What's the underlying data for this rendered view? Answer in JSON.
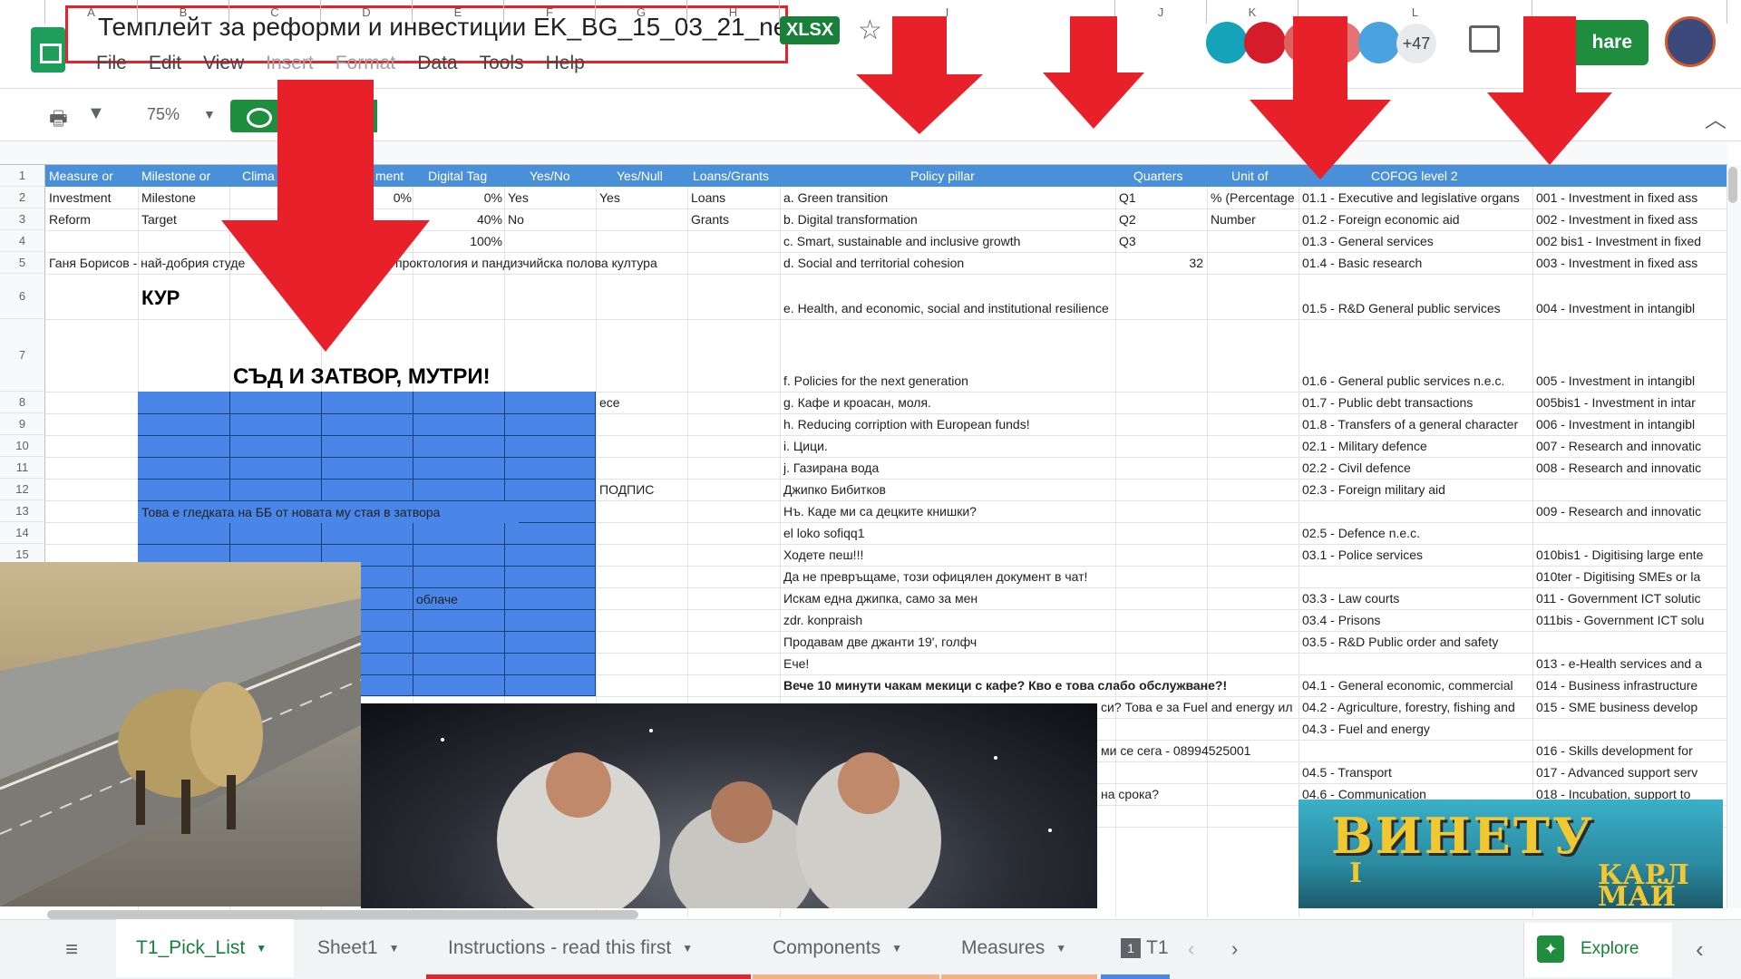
{
  "header": {
    "title": "Темплейт за реформи и инвестиции EK_BG_15_03_21_new",
    "file_badge": "XLSX",
    "menu": [
      "File",
      "Edit",
      "View",
      "Insert",
      "Format",
      "Data",
      "Tools",
      "Help"
    ],
    "collaborators_more": "+47",
    "share_label": "hare"
  },
  "toolbar": {
    "zoom": "75%"
  },
  "columns": [
    "A",
    "B",
    "C",
    "D",
    "E",
    "F",
    "G",
    "H",
    "I",
    "J",
    "K",
    "L"
  ],
  "rows": [
    "1",
    "2",
    "3",
    "4",
    "5",
    "6",
    "7",
    "8",
    "9",
    "10",
    "11",
    "12",
    "13",
    "14",
    "15"
  ],
  "header_row": {
    "a": "Measure or",
    "b": "Milestone or",
    "c": "Clima",
    "d": "ment",
    "e": "Digital Tag",
    "f": "Yes/No",
    "g": "Yes/Null",
    "h": "Loans/Grants",
    "i": "Policy pillar",
    "j": "Quarters",
    "k": "Unit of",
    "l": "COFOG level 2"
  },
  "cells": {
    "a2": "Investment",
    "b2": "Milestone",
    "d2": "0%",
    "e2": "0%",
    "f2": "Yes",
    "g2": "Yes",
    "h2": "Loans",
    "j2": "Q1",
    "k2": "% (Percentage",
    "a3": "Reform",
    "b3": "Target",
    "e3": "40%",
    "f3": "No",
    "h3": "Grants",
    "j3": "Q2",
    "k3": "Number",
    "d4": "%",
    "e4": "100%",
    "j4": "Q3",
    "a5": "Ганя Борисов - най-добрия студе",
    "d5": "проктология и пандизчийска полова култура",
    "j5": "32",
    "b6": "КУР",
    "c7": "СЪД И ЗАТВОР, МУТРИ!",
    "g8": "есе",
    "g12": "ПОДПИС",
    "b13": "Това е гледката на ББ от новата му стая в затвора",
    "e18": "облаче"
  },
  "policy_pillar": [
    "a. Green transition",
    "b. Digital transformation",
    "c. Smart, sustainable and inclusive growth",
    "d. Social and territorial cohesion",
    "e. Health, and economic, social and institutional resilience",
    "f. Policies for the next generation",
    "g. Кафе и кроасан, моля.",
    "h. Reducing corription with European funds!",
    "i. Цици.",
    "j. Газирана вода",
    "Джипко Бибитков",
    "Нъ. Каде ми са децките книшки?",
    "el loko sofiqq1",
    "Ходете пеш!!!",
    "Да не превръщаме, този офицялен документ в чат!",
    "Искам една джипка, само за мен",
    "zdr. konpraish",
    "Продавам две джанти 19', голфч",
    "Ече!",
    "Вече 10 минути чакам мекици с кафе? Кво е това слабо обслужване?!"
  ],
  "policy_pillar_tail": [
    "си? Това е за Fuel and energy ил",
    "ми се сега - 08994525001",
    "на срока?"
  ],
  "cofog": [
    "01.1 - Executive and legislative organs",
    "01.2 - Foreign economic aid",
    "01.3 - General services",
    "01.4 - Basic research",
    "01.5 - R&D General public services",
    "01.6 - General public services n.e.c.",
    "01.7 - Public debt transactions",
    "01.8 - Transfers of a general character",
    "02.1 - Military defence",
    "02.2 - Civil defence",
    "02.3 - Foreign military aid",
    "",
    "02.5 - Defence n.e.c.",
    "03.1 - Police services",
    "",
    "03.3 - Law courts",
    "03.4 - Prisons",
    "03.5 - R&D Public order and safety",
    "",
    "04.1 - General economic, commercial",
    "04.2 - Agriculture, forestry, fishing and",
    "04.3 - Fuel and energy",
    "",
    "04.5 - Transport",
    "04.6 - Communication"
  ],
  "col_m": [
    "001 - Investment in fixed ass",
    "002 - Investment in fixed ass",
    "002 bis1 - Investment in fixed",
    "003 - Investment in fixed ass",
    "004 - Investment in intangibl",
    "005 - Investment in intangibl",
    "005bis1 - Investment in intar",
    "006 - Investment in intangibl",
    "007 - Research and innovatic",
    "008 - Research and innovatic",
    "",
    "009 - Research and innovatic",
    "",
    "010bis1 - Digitising large ente",
    "010ter - Digitising SMEs or la",
    "011 - Government ICT solutic",
    "011bis - Government ICT solu",
    "",
    "013 - e-Health services and a",
    "014 - Business infrastructure",
    "015 - SME business develop",
    "",
    "016 - Skills development for",
    "017 - Advanced support serv",
    "018 - Incubation, support to"
  ],
  "images": {
    "right_caption_1": "ВИНЕТУ",
    "right_caption_2": "I",
    "right_caption_3": "КАРЛ",
    "right_caption_4": "МАЙ"
  },
  "tabs": [
    "T1_Pick_List",
    "Sheet1",
    "Instructions - read this first",
    "Components",
    "Measures",
    "T1"
  ],
  "explore_label": "Explore",
  "colors": {
    "accent_green": "#188038",
    "header_blue": "#4a90d9",
    "block_blue": "#4a86e8",
    "arrow_red": "#e8202a"
  }
}
